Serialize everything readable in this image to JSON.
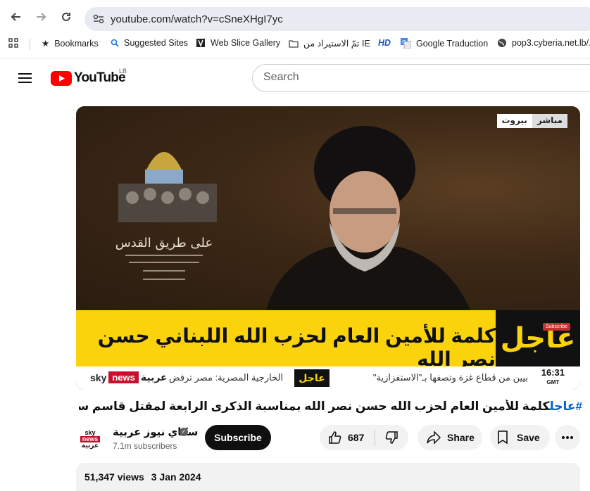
{
  "browser": {
    "url": "youtube.com/watch?v=cSneXHgI7yc",
    "bookmarks": [
      {
        "label": "Bookmarks",
        "icon": "star-icon"
      },
      {
        "label": "Suggested Sites",
        "icon": "search-icon"
      },
      {
        "label": "Web Slice Gallery",
        "icon": "web-slice-icon"
      },
      {
        "label": "تمّ الاستيراد من IE",
        "icon": "folder-icon"
      },
      {
        "label": "HD",
        "icon": "hd-icon"
      },
      {
        "label": "Google Traduction",
        "icon": "translate-icon"
      },
      {
        "label": "pop3.cyberia.net.lb/...",
        "icon": "globe-icon"
      }
    ]
  },
  "youtube": {
    "logo_word": "YouTube",
    "country_code": "LB",
    "search_placeholder": "Search"
  },
  "video": {
    "overlay_location": "بيروت",
    "overlay_live": "مباشر",
    "banner_text": "كلمة للأمين العام لحزب الله اللبناني حسن نصر الله",
    "banner_tag": "عاجل",
    "watermark_subscribe": "Subscribe",
    "ticker_brand_sky": "sky",
    "ticker_brand_news": "news",
    "ticker_brand_arabic": "عربية",
    "ticker_text_left": "الخارجية المصرية: مصر ترفض",
    "ticker_tag": "عاجل",
    "ticker_text_right": "بيين من قطاع غزة وتصفها بـ\"الاستفزازية\"",
    "ticker_time": "16:31",
    "ticker_tz": "GMT"
  },
  "title": {
    "hashtag": "#عاجل",
    "text": "كلمة للأمين العام لحزب الله حسن نصر الله بمناسبة الذكرى الرابعة لمقتل قاسم سليماني |"
  },
  "channel": {
    "name": "سكاي نيوز عربية",
    "subscribers": "7.1m subscribers",
    "logo_sky": "sky",
    "logo_news": "news",
    "logo_arabic": "عربية",
    "subscribe_label": "Subscribe"
  },
  "actions": {
    "like_count": "687",
    "share_label": "Share",
    "save_label": "Save"
  },
  "description": {
    "views": "51,347 views",
    "date": "3 Jan 2024"
  },
  "colors": {
    "youtube_red": "#ff0000",
    "banner_yellow": "#fbd30c",
    "sky_news_red": "#c8102e",
    "hashtag_blue": "#065fd4"
  }
}
